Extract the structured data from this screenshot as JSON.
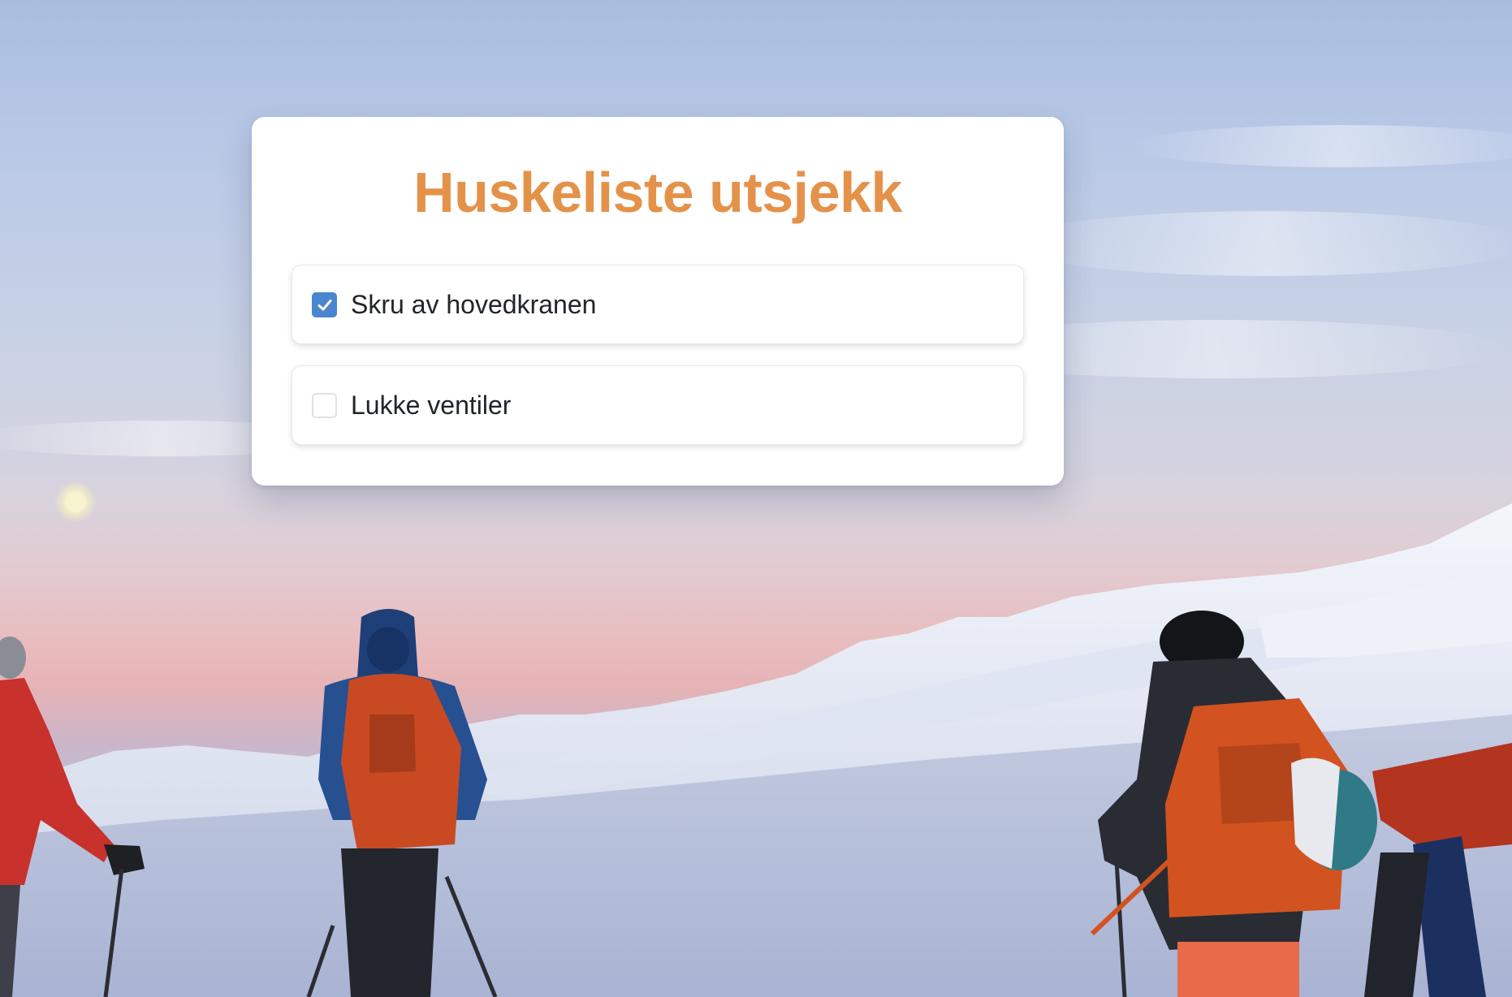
{
  "page": {
    "title": "Huskeliste utsjekk"
  },
  "checklist": {
    "items": [
      {
        "label": "Skru av hovedkranen",
        "checked": true
      },
      {
        "label": "Lukke ventiler",
        "checked": false
      }
    ]
  },
  "colors": {
    "title": "#e4924a",
    "checkbox_checked": "#4a86cf",
    "checkbox_unchecked_border": "#dfe2e7"
  },
  "icons": {
    "check": "checkmark-icon"
  }
}
